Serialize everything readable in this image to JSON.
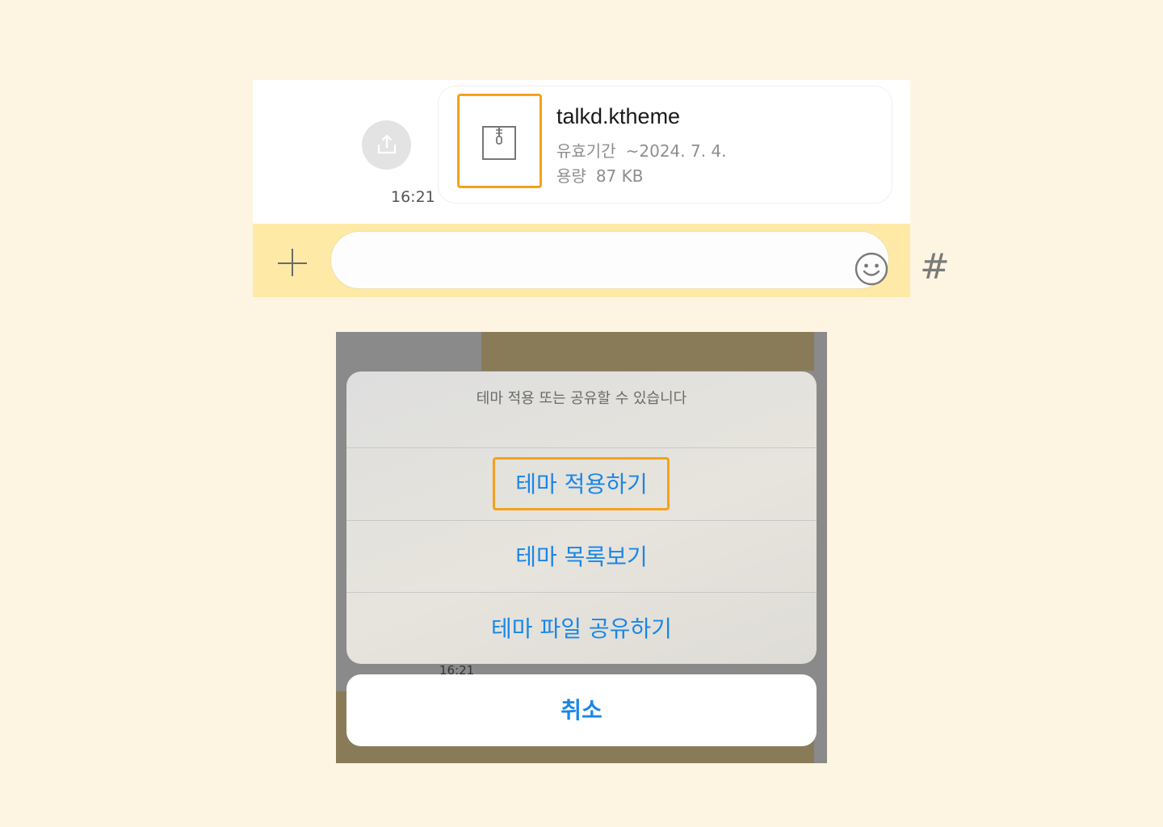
{
  "chat": {
    "timestamp": "16:21",
    "file": {
      "name": "talkd.ktheme",
      "expiry_label": "유효기간",
      "expiry_value": "~2024. 7. 4.",
      "size_label": "용량",
      "size_value": "87 KB"
    },
    "input": {
      "placeholder": "",
      "hash_symbol": "#"
    },
    "icons": {
      "share": "share-upload-icon",
      "plus": "plus-icon",
      "emoji": "emoji-icon",
      "file": "zip-file-icon"
    }
  },
  "action_sheet": {
    "title": "테마 적용 또는 공유할 수 있습니다",
    "actions": [
      {
        "label": "테마 적용하기"
      },
      {
        "label": "테마 목록보기"
      },
      {
        "label": "테마 파일 공유하기"
      }
    ],
    "cancel_label": "취소",
    "background_timestamp": "16:21"
  },
  "colors": {
    "highlight": "#f5a11c",
    "action_blue": "#1a86e8",
    "input_bar": "#fee9a6",
    "page_bg": "#fdf5e1"
  }
}
